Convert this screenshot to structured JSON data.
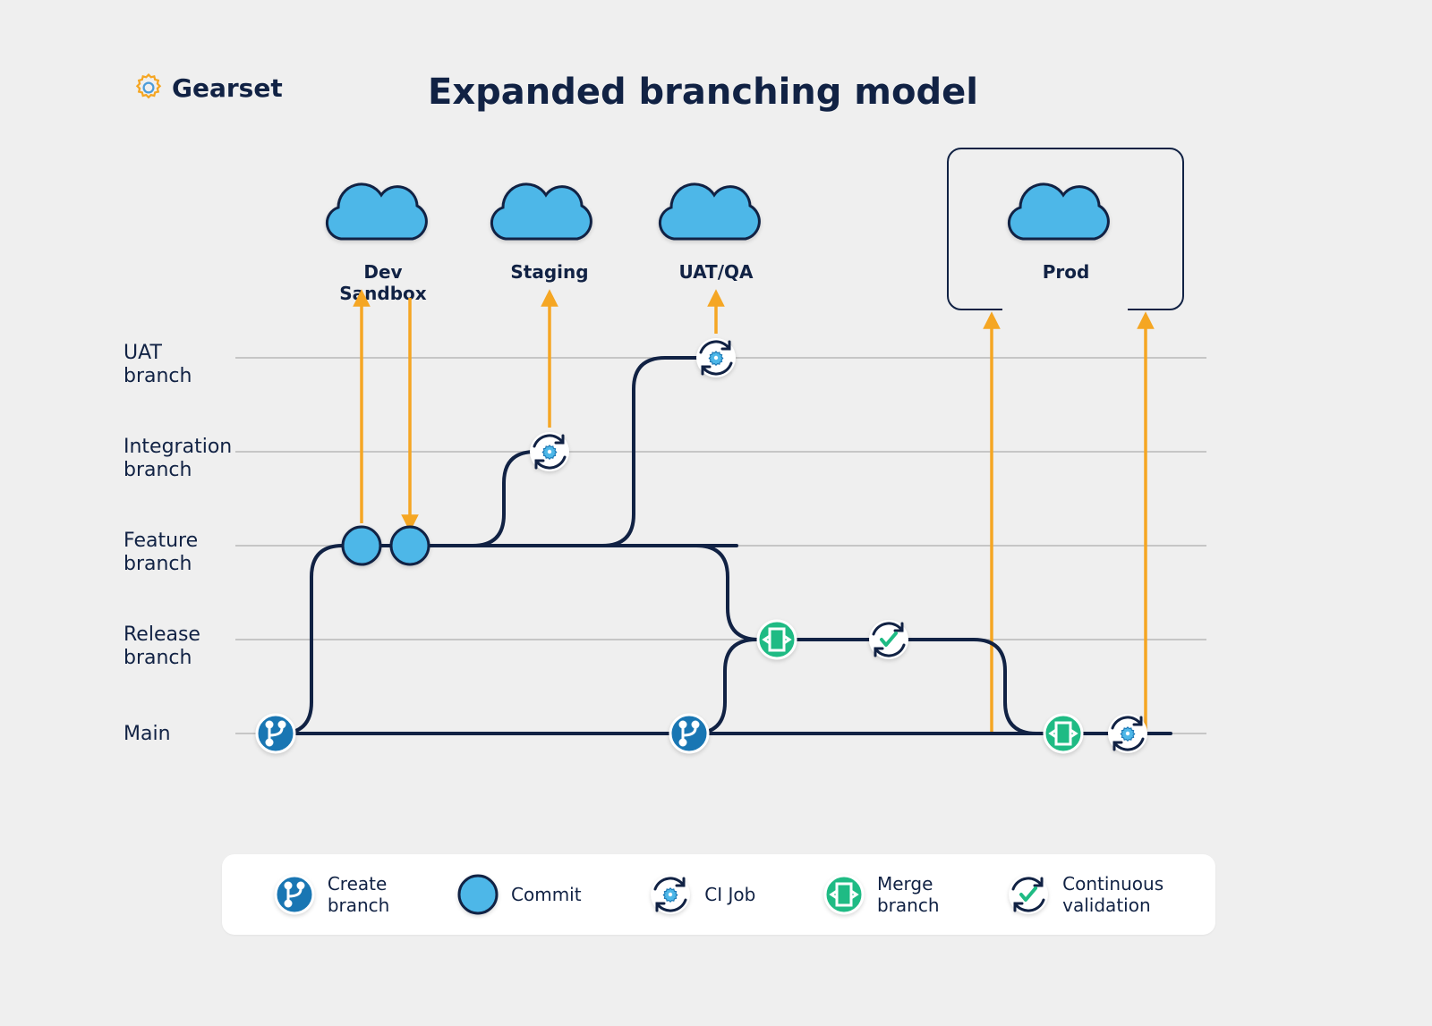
{
  "brand": "Gearset",
  "title": "Expanded branching model",
  "environments": {
    "dev": "Dev Sandbox",
    "staging": "Staging",
    "uat": "UAT/QA",
    "prod": "Prod"
  },
  "branches": {
    "uat": "UAT\nbranch",
    "integration": "Integration\nbranch",
    "feature": "Feature\nbranch",
    "release": "Release\nbranch",
    "main": "Main"
  },
  "legend": {
    "create": "Create\nbranch",
    "commit": "Commit",
    "ci": "CI Job",
    "merge": "Merge\nbranch",
    "validate": "Continuous\nvalidation"
  },
  "colors": {
    "light": "#4DB7E8",
    "dark": "#1976B3",
    "line": "#112244",
    "green": "#1FBB84",
    "orange": "#F5A623"
  }
}
